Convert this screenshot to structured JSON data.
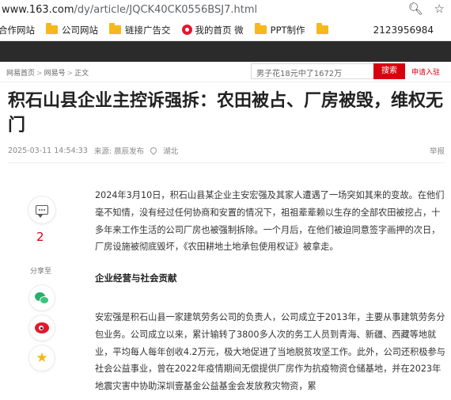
{
  "browser": {
    "url_host": "www.163.com",
    "url_path": "/dy/article/JQCK40CK0556BSJ7.html"
  },
  "bookmarks": [
    {
      "label": "合作网站",
      "icon": "folder-icon"
    },
    {
      "label": "公司网站",
      "icon": "folder-icon"
    },
    {
      "label": "链接广告交",
      "icon": "folder-icon"
    },
    {
      "label": "我的首页 微",
      "icon": "weibo-icon"
    },
    {
      "label": "PPT制作",
      "icon": "folder-icon"
    },
    {
      "label": "",
      "icon": "folder-icon"
    }
  ],
  "bookmark_phone": "2123956984",
  "nav": {
    "crumbs": [
      "网易首页",
      "网易号",
      "正文"
    ],
    "search_placeholder": "男子花18元中了1672万",
    "search_button": "搜索",
    "join_label": "申请入驻"
  },
  "article": {
    "title": "积石山县企业主控诉强拆：农田被占、厂房被毁，维权无门",
    "date": "2025-03-11 14:54:33",
    "source": "来源: 晨辰发布",
    "location": "湖北",
    "report": "举报",
    "paragraph1": "2024年3月10日，积石山县某企业主安宏强及其家人遭遇了一场突如其来的变故。在他们毫不知情，没有经过任何协商和安置的情况下，祖祖辈辈赖以生存的全部农田被挖占，十多年来工作生活的公司厂房也被强制拆除。一个月后，在他们被迫同意签字画押的次日，厂房设施被彻底毁坏，《农田耕地土地承包使用权证》被拿走。",
    "heading": "企业经营与社会贡献",
    "paragraph2": "安宏强是积石山县一家建筑劳务公司的负责人，公司成立于2013年，主要从事建筑劳务分包业务。公司成立以来，累计输转了3800多人次的务工人员到青海、新疆、西藏等地就业，平均每人每年创收4.2万元，极大地促进了当地脱贫攻坚工作。此外，公司还积极参与社会公益事业，曾在2022年疫情期间无偿提供厂房作为抗疫物资仓储基地，并在2023年地震灾害中协助深圳壹基金公益基金会发放救灾物资，累"
  },
  "share": {
    "comment_count": "2",
    "share_label": "分享至"
  },
  "colors": {
    "accent": "#d7000f",
    "darkbar": "#2b2b2b",
    "folder": "#f5b81d"
  }
}
